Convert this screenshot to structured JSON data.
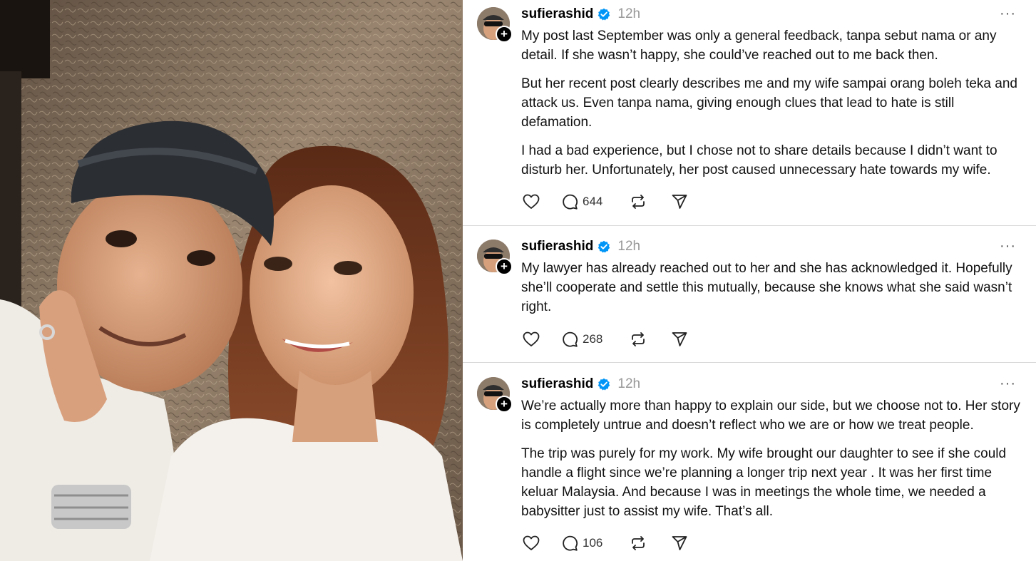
{
  "posts": [
    {
      "username": "sufierashid",
      "time": "12h",
      "paragraphs": [
        "My post last September was only a general feedback, tanpa sebut nama or any detail. If she wasn’t happy, she could’ve reached out to me back then.",
        "But her recent post clearly describes me and my wife sampai orang boleh teka and attack us. Even tanpa nama, giving enough clues that lead to hate is still defamation.",
        "I had a bad experience, but I chose not to share details because I didn’t want to disturb her. Unfortunately, her post caused unnecessary hate towards my wife."
      ],
      "reply_count": "644"
    },
    {
      "username": "sufierashid",
      "time": "12h",
      "paragraphs": [
        "My lawyer has already reached out to her and she has acknowledged it. Hopefully she’ll cooperate and settle this mutually, because she knows what she said wasn’t right."
      ],
      "reply_count": "268"
    },
    {
      "username": "sufierashid",
      "time": "12h",
      "paragraphs": [
        "We’re actually more than happy to explain our side, but we choose not to. Her story is completely untrue and doesn’t reflect who we are or how we treat people.",
        "The trip was purely for my work. My wife brought our daughter to see if she could handle a flight since we’re planning a longer trip next year . It was her first time keluar Malaysia. And because I was in meetings the whole time, we needed a babysitter just to assist my wife. That’s all."
      ],
      "reply_count": "106"
    }
  ],
  "more_glyph": "···",
  "plus_glyph": "+",
  "colors": {
    "verified": "#0095f6",
    "muted": "#999999",
    "divider": "#d9d9d9"
  },
  "icons": [
    "heart-icon",
    "comment-icon",
    "repost-icon",
    "share-icon",
    "verified-badge-icon",
    "more-icon"
  ]
}
